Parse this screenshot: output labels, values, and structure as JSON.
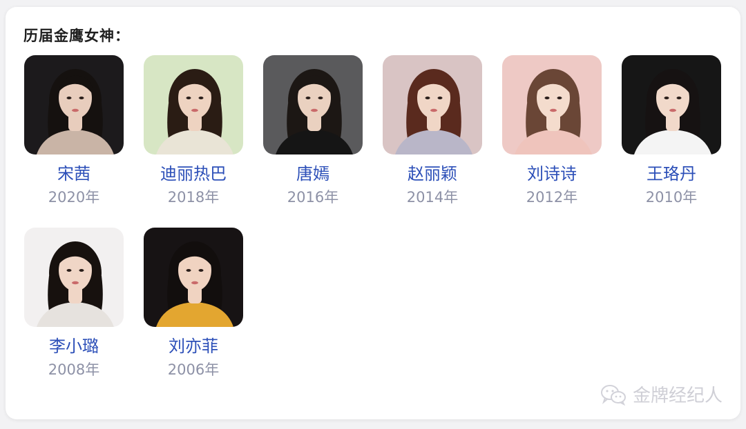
{
  "title": "历届金鹰女神：",
  "people": [
    {
      "name": "宋茜",
      "year": "2020年",
      "bg": "#1c1a1c",
      "hair": "#15110f",
      "skin": "#e8cdbd",
      "cloth": "#c9b4a6"
    },
    {
      "name": "迪丽热巴",
      "year": "2018年",
      "bg": "#d7e6c4",
      "hair": "#2a1c14",
      "skin": "#eed3c1",
      "cloth": "#e9e4d6"
    },
    {
      "name": "唐嫣",
      "year": "2016年",
      "bg": "#5a5a5c",
      "hair": "#1c1714",
      "skin": "#ead1c0",
      "cloth": "#151515"
    },
    {
      "name": "赵丽颖",
      "year": "2014年",
      "bg": "#d9c4c4",
      "hair": "#5a2a1e",
      "skin": "#f0d6c6",
      "cloth": "#b9b6c8"
    },
    {
      "name": "刘诗诗",
      "year": "2012年",
      "bg": "#eec9c5",
      "hair": "#6a4636",
      "skin": "#f4dccd",
      "cloth": "#efc4bc"
    },
    {
      "name": "王珞丹",
      "year": "2010年",
      "bg": "#161616",
      "hair": "#161212",
      "skin": "#f1d9ca",
      "cloth": "#f4f4f4"
    },
    {
      "name": "李小璐",
      "year": "2008年",
      "bg": "#f2f0f0",
      "hair": "#17110e",
      "skin": "#f0d6c6",
      "cloth": "#e6e2de"
    },
    {
      "name": "刘亦菲",
      "year": "2006年",
      "bg": "#171314",
      "hair": "#120e0d",
      "skin": "#f0d3c1",
      "cloth": "#e3a630"
    }
  ],
  "watermark": {
    "text": "金牌经纪人",
    "icon": "wechat-icon"
  }
}
